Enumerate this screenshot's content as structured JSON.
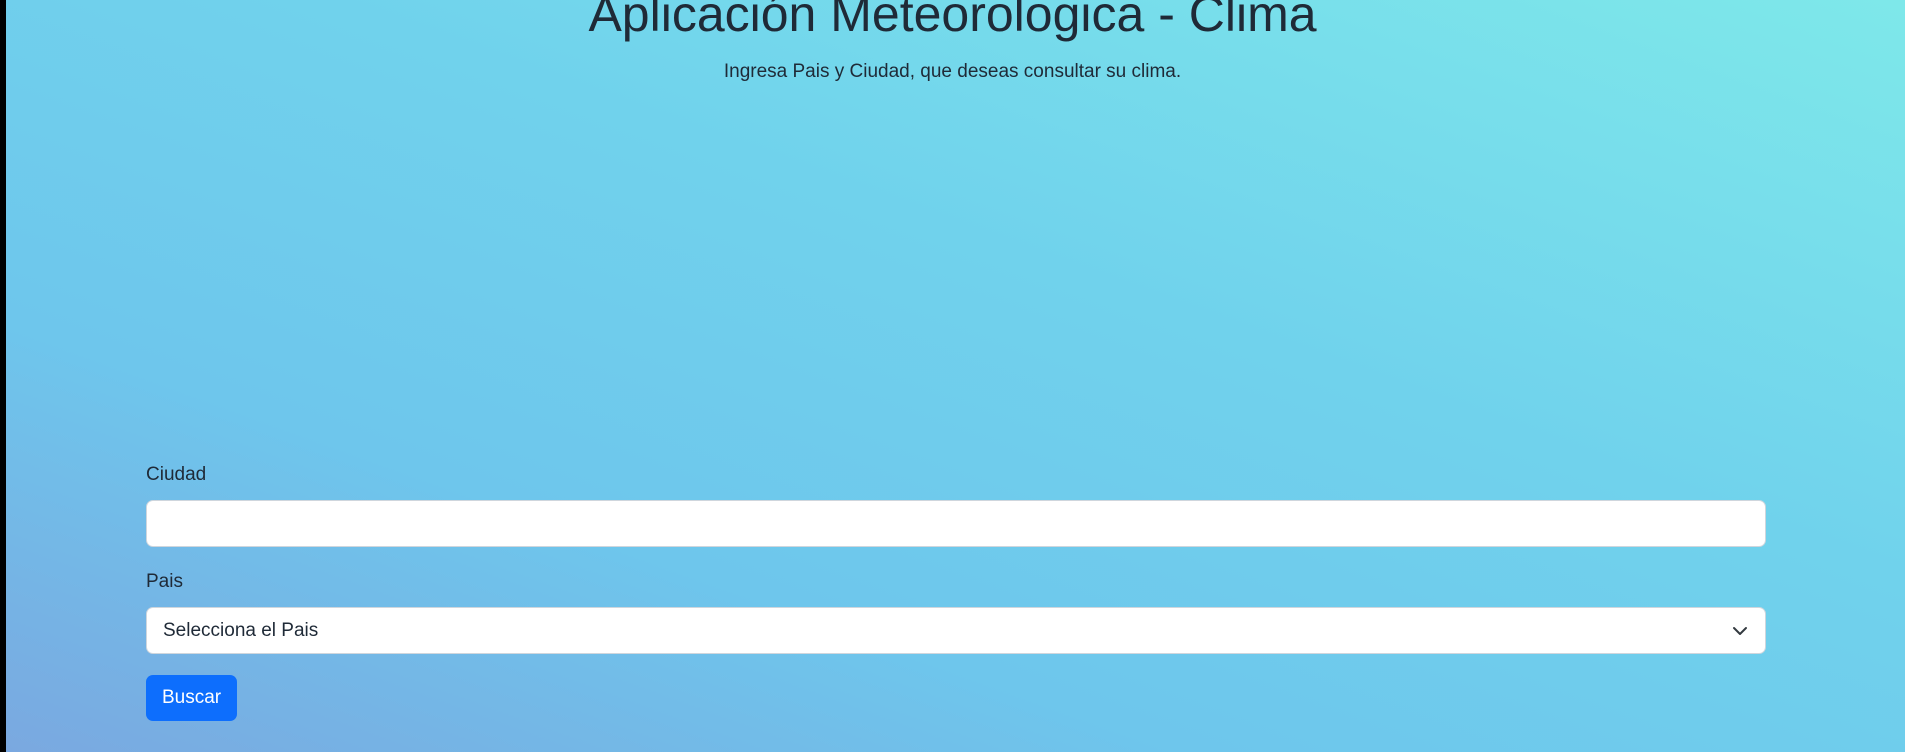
{
  "page": {
    "title": "Aplicación Meteorologica - Clima",
    "subtitle": "Ingresa Pais y Ciudad, que deseas consultar su clima."
  },
  "form": {
    "city": {
      "label": "Ciudad",
      "value": "",
      "placeholder": ""
    },
    "country": {
      "label": "Pais",
      "selected": "Selecciona el Pais"
    },
    "submit_label": "Buscar"
  },
  "colors": {
    "button": "#0d6efd",
    "background_top": "#7ee8ea",
    "background_bottom": "#7aa8e0",
    "text": "#1f2a37"
  },
  "icons": {
    "select_arrow": "chevron-down-icon"
  }
}
